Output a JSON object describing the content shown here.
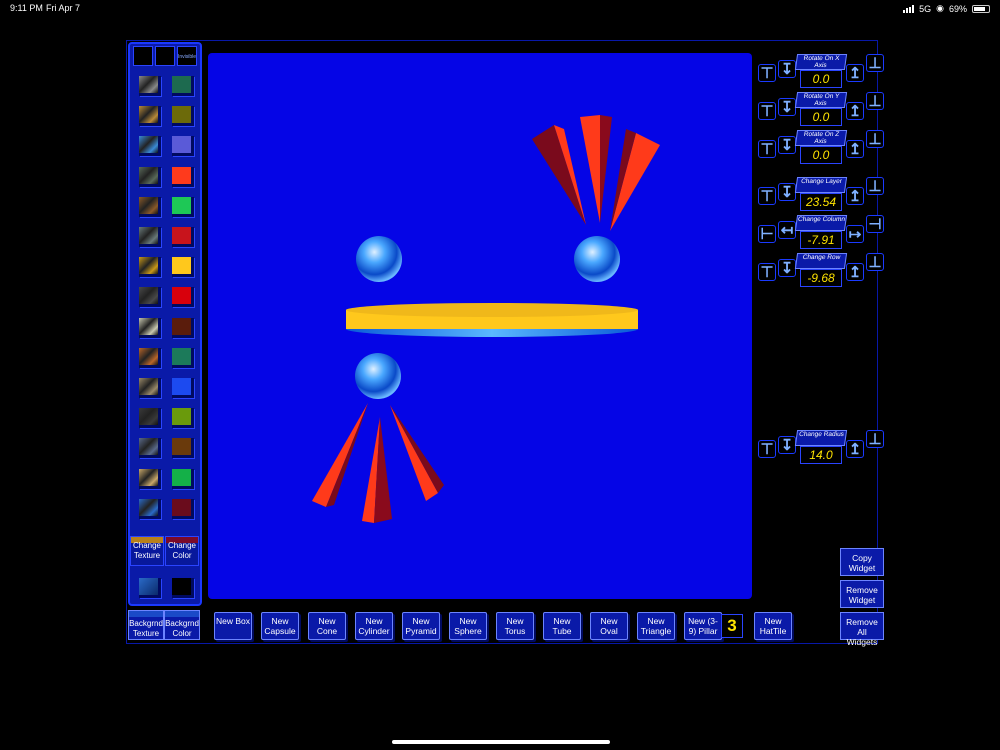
{
  "status_bar": {
    "time": "9:11 PM",
    "date": "Fri Apr 7",
    "network": "5G",
    "battery": "69%"
  },
  "palette": {
    "top_label": "Invisible",
    "change_texture": "Change Texture",
    "change_color": "Change Color",
    "colors": [
      "#1d6a4f",
      "#6c6a0a",
      "#5a5ad8",
      "#ff3a1c",
      "#1ec856",
      "#c8141c",
      "#ffc81c",
      "#d8000c",
      "#5a1c0c",
      "#1c7a5a",
      "#1c4af0",
      "#6a9a0c",
      "#6a3a0c",
      "#14b048",
      "#6a0c1c"
    ],
    "textures": [
      "#8a8a8a",
      "#b88a3a",
      "#3a8ad8",
      "#5a6a5a",
      "#8a5a2a",
      "#6a7a7a",
      "#c8981a",
      "#4a4a4a",
      "#c8c8b0",
      "#b8662a",
      "#9a8a6a",
      "#3a3a3a",
      "#5a6a8a",
      "#c8a86a",
      "#2a6ac8"
    ]
  },
  "controls": [
    {
      "label": "Rotate On X Axis",
      "value": "0.0"
    },
    {
      "label": "Rotate On Y Axis",
      "value": "0.0"
    },
    {
      "label": "Rotate On Z Axis",
      "value": "0.0"
    },
    {
      "label": "Change Layer",
      "value": "23.54"
    },
    {
      "label": "Change Column",
      "value": "-7.91"
    },
    {
      "label": "Change Row",
      "value": "-9.68"
    },
    {
      "label": "Change Radius",
      "value": "14.0"
    }
  ],
  "side_buttons": {
    "copy": "Copy Widget",
    "remove": "Remove Widget",
    "remove_all": "Remove All Widgets"
  },
  "toolbar": {
    "bg_texture": "Backgrnd Texture",
    "bg_color": "Backgrnd Color",
    "buttons": [
      "New Box",
      "New Capsule",
      "New Cone",
      "New Cylinder",
      "New Pyramid",
      "New Sphere",
      "New Torus",
      "New Tube",
      "New Oval",
      "New Triangle",
      "New (3-9) Pillar",
      "New HatTile"
    ],
    "pillar_count": "3"
  }
}
